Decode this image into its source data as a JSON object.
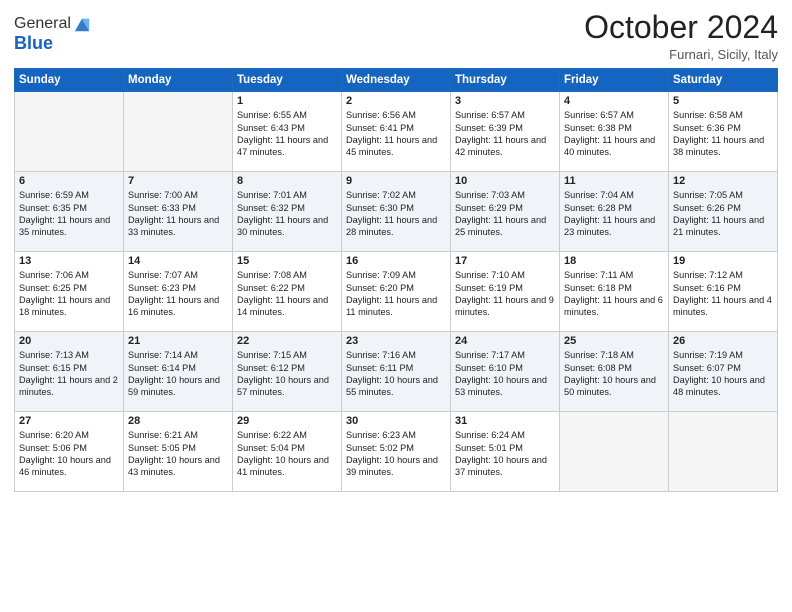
{
  "logo": {
    "general": "General",
    "blue": "Blue"
  },
  "title": "October 2024",
  "subtitle": "Furnari, Sicily, Italy",
  "weekdays": [
    "Sunday",
    "Monday",
    "Tuesday",
    "Wednesday",
    "Thursday",
    "Friday",
    "Saturday"
  ],
  "weeks": [
    [
      {
        "day": "",
        "empty": true
      },
      {
        "day": "",
        "empty": true
      },
      {
        "day": "1",
        "sunrise": "6:55 AM",
        "sunset": "6:43 PM",
        "daylight": "11 hours and 47 minutes."
      },
      {
        "day": "2",
        "sunrise": "6:56 AM",
        "sunset": "6:41 PM",
        "daylight": "11 hours and 45 minutes."
      },
      {
        "day": "3",
        "sunrise": "6:57 AM",
        "sunset": "6:39 PM",
        "daylight": "11 hours and 42 minutes."
      },
      {
        "day": "4",
        "sunrise": "6:57 AM",
        "sunset": "6:38 PM",
        "daylight": "11 hours and 40 minutes."
      },
      {
        "day": "5",
        "sunrise": "6:58 AM",
        "sunset": "6:36 PM",
        "daylight": "11 hours and 38 minutes."
      }
    ],
    [
      {
        "day": "6",
        "sunrise": "6:59 AM",
        "sunset": "6:35 PM",
        "daylight": "11 hours and 35 minutes."
      },
      {
        "day": "7",
        "sunrise": "7:00 AM",
        "sunset": "6:33 PM",
        "daylight": "11 hours and 33 minutes."
      },
      {
        "day": "8",
        "sunrise": "7:01 AM",
        "sunset": "6:32 PM",
        "daylight": "11 hours and 30 minutes."
      },
      {
        "day": "9",
        "sunrise": "7:02 AM",
        "sunset": "6:30 PM",
        "daylight": "11 hours and 28 minutes."
      },
      {
        "day": "10",
        "sunrise": "7:03 AM",
        "sunset": "6:29 PM",
        "daylight": "11 hours and 25 minutes."
      },
      {
        "day": "11",
        "sunrise": "7:04 AM",
        "sunset": "6:28 PM",
        "daylight": "11 hours and 23 minutes."
      },
      {
        "day": "12",
        "sunrise": "7:05 AM",
        "sunset": "6:26 PM",
        "daylight": "11 hours and 21 minutes."
      }
    ],
    [
      {
        "day": "13",
        "sunrise": "7:06 AM",
        "sunset": "6:25 PM",
        "daylight": "11 hours and 18 minutes."
      },
      {
        "day": "14",
        "sunrise": "7:07 AM",
        "sunset": "6:23 PM",
        "daylight": "11 hours and 16 minutes."
      },
      {
        "day": "15",
        "sunrise": "7:08 AM",
        "sunset": "6:22 PM",
        "daylight": "11 hours and 14 minutes."
      },
      {
        "day": "16",
        "sunrise": "7:09 AM",
        "sunset": "6:20 PM",
        "daylight": "11 hours and 11 minutes."
      },
      {
        "day": "17",
        "sunrise": "7:10 AM",
        "sunset": "6:19 PM",
        "daylight": "11 hours and 9 minutes."
      },
      {
        "day": "18",
        "sunrise": "7:11 AM",
        "sunset": "6:18 PM",
        "daylight": "11 hours and 6 minutes."
      },
      {
        "day": "19",
        "sunrise": "7:12 AM",
        "sunset": "6:16 PM",
        "daylight": "11 hours and 4 minutes."
      }
    ],
    [
      {
        "day": "20",
        "sunrise": "7:13 AM",
        "sunset": "6:15 PM",
        "daylight": "11 hours and 2 minutes."
      },
      {
        "day": "21",
        "sunrise": "7:14 AM",
        "sunset": "6:14 PM",
        "daylight": "10 hours and 59 minutes."
      },
      {
        "day": "22",
        "sunrise": "7:15 AM",
        "sunset": "6:12 PM",
        "daylight": "10 hours and 57 minutes."
      },
      {
        "day": "23",
        "sunrise": "7:16 AM",
        "sunset": "6:11 PM",
        "daylight": "10 hours and 55 minutes."
      },
      {
        "day": "24",
        "sunrise": "7:17 AM",
        "sunset": "6:10 PM",
        "daylight": "10 hours and 53 minutes."
      },
      {
        "day": "25",
        "sunrise": "7:18 AM",
        "sunset": "6:08 PM",
        "daylight": "10 hours and 50 minutes."
      },
      {
        "day": "26",
        "sunrise": "7:19 AM",
        "sunset": "6:07 PM",
        "daylight": "10 hours and 48 minutes."
      }
    ],
    [
      {
        "day": "27",
        "sunrise": "6:20 AM",
        "sunset": "5:06 PM",
        "daylight": "10 hours and 46 minutes."
      },
      {
        "day": "28",
        "sunrise": "6:21 AM",
        "sunset": "5:05 PM",
        "daylight": "10 hours and 43 minutes."
      },
      {
        "day": "29",
        "sunrise": "6:22 AM",
        "sunset": "5:04 PM",
        "daylight": "10 hours and 41 minutes."
      },
      {
        "day": "30",
        "sunrise": "6:23 AM",
        "sunset": "5:02 PM",
        "daylight": "10 hours and 39 minutes."
      },
      {
        "day": "31",
        "sunrise": "6:24 AM",
        "sunset": "5:01 PM",
        "daylight": "10 hours and 37 minutes."
      },
      {
        "day": "",
        "empty": true
      },
      {
        "day": "",
        "empty": true
      }
    ]
  ],
  "labels": {
    "sunrise": "Sunrise:",
    "sunset": "Sunset:",
    "daylight": "Daylight:"
  }
}
